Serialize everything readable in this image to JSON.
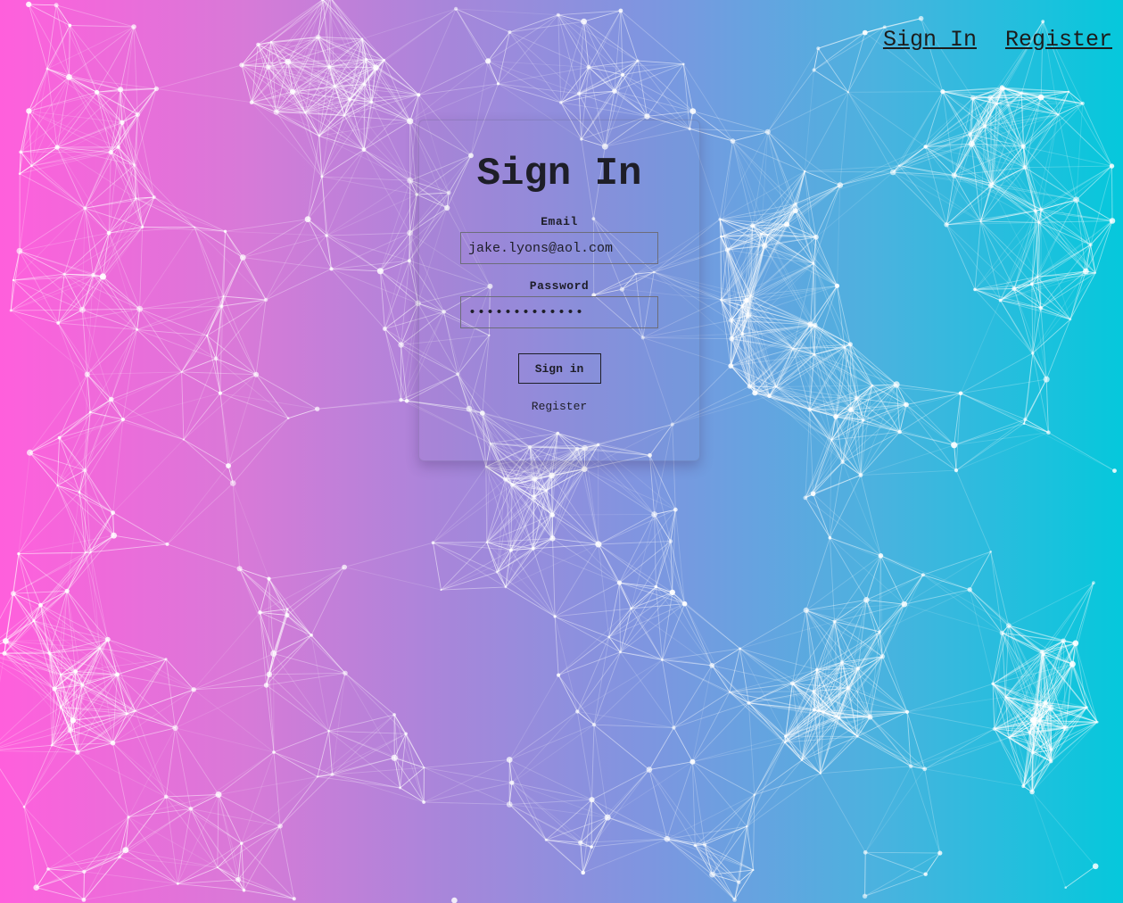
{
  "nav": {
    "sign_in": "Sign In",
    "register": "Register"
  },
  "form": {
    "title": "Sign In",
    "email_label": "Email",
    "email_value": "jake.lyons@aol.com",
    "password_label": "Password",
    "password_value": "•••••••••••••",
    "submit_label": "Sign in",
    "register_label": "Register"
  },
  "theme": {
    "gradient_left": "#ff5fdc",
    "gradient_right": "#05c8dc",
    "text_color": "#1e1e28",
    "network_color": "#ffffff"
  }
}
